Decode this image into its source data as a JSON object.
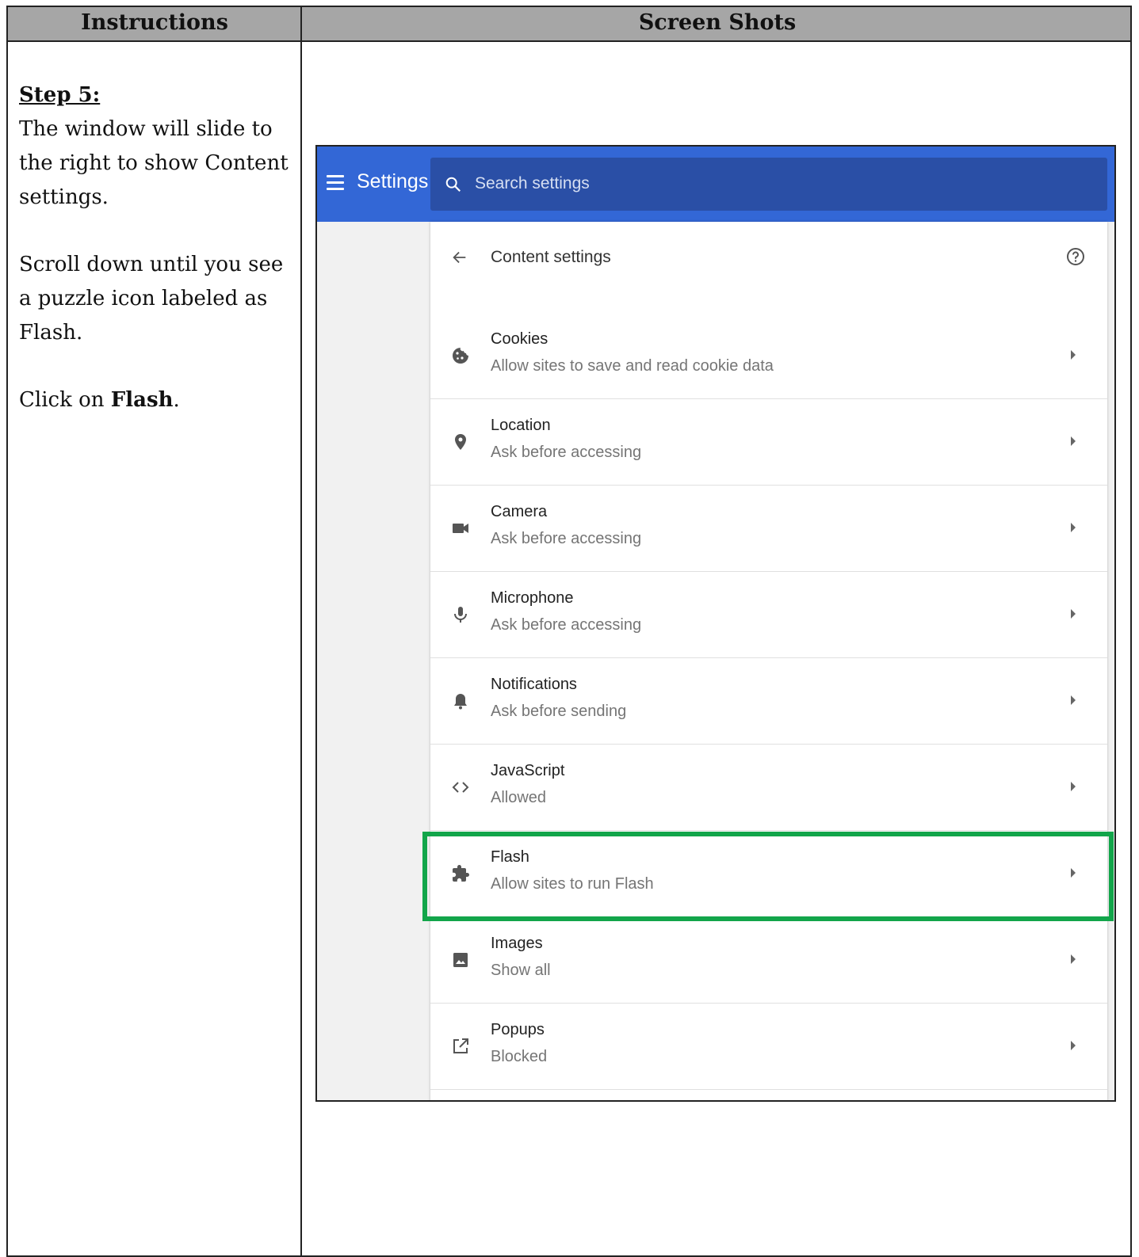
{
  "table": {
    "header_left": "Instructions",
    "header_right": "Screen Shots"
  },
  "instructions": {
    "step_title": "Step 5:",
    "para1": "The window will slide to the right to show Content settings.",
    "para2": "Scroll down until you see a puzzle icon labeled as Flash.",
    "para3_prefix": "Click on ",
    "para3_bold": "Flash",
    "para3_suffix": "."
  },
  "screenshot": {
    "app_title": "Settings",
    "search_placeholder": "Search settings",
    "page_title": "Content settings",
    "accent_color": "#3367d6",
    "highlight_color": "#12a54a",
    "items": [
      {
        "icon": "cookie-icon",
        "label": "Cookies",
        "sub": "Allow sites to save and read cookie data"
      },
      {
        "icon": "location-pin-icon",
        "label": "Location",
        "sub": "Ask before accessing"
      },
      {
        "icon": "camera-icon",
        "label": "Camera",
        "sub": "Ask before accessing"
      },
      {
        "icon": "microphone-icon",
        "label": "Microphone",
        "sub": "Ask before accessing"
      },
      {
        "icon": "bell-icon",
        "label": "Notifications",
        "sub": "Ask before sending"
      },
      {
        "icon": "code-icon",
        "label": "JavaScript",
        "sub": "Allowed"
      },
      {
        "icon": "puzzle-icon",
        "label": "Flash",
        "sub": "Allow sites to run Flash"
      },
      {
        "icon": "image-icon",
        "label": "Images",
        "sub": "Show all"
      },
      {
        "icon": "popup-icon",
        "label": "Popups",
        "sub": "Blocked"
      }
    ]
  }
}
